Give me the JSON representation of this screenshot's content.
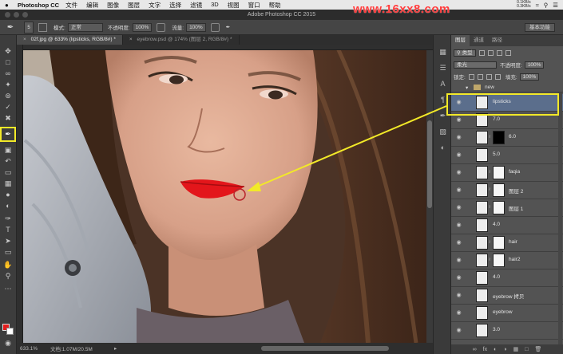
{
  "menubar": {
    "app_name": "Photoshop CC",
    "items": [
      "文件",
      "编辑",
      "图像",
      "图层",
      "文字",
      "选择",
      "滤镜",
      "3D",
      "视图",
      "窗口",
      "帮助"
    ],
    "rate_up": "0.1KB/s",
    "rate_down": "0.3KB/s"
  },
  "watermark": "www.16xx8.com",
  "window": {
    "title": "Adobe Photoshop CC 2015"
  },
  "options": {
    "brush_size": "5",
    "mode_label": "模式:",
    "mode_value": "正常",
    "opacity_label": "不透明度:",
    "opacity_value": "100%",
    "flow_label": "流量:",
    "flow_value": "100%",
    "workspace": "基本功能"
  },
  "tabs": [
    {
      "label": "02f.jpg @ 633% (lipsticks, RGB/8#) *",
      "active": true
    },
    {
      "label": "eyebrow.psd @ 174% (图层 2, RGB/8#) *",
      "active": false
    }
  ],
  "status": {
    "zoom": "633.1%",
    "doc": "文档:1.07M/20.5M"
  },
  "layers_panel": {
    "tabs": [
      "图层",
      "通道",
      "路径"
    ],
    "kind_label": "类型",
    "blend_mode": "柔光",
    "opacity_label": "不透明度:",
    "opacity_value": "100%",
    "lock_label": "锁定:",
    "fill_label": "填充:",
    "fill_value": "100%",
    "folder_name": "new",
    "layers": [
      {
        "name": "lipsticks",
        "selected": true,
        "mask": "none"
      },
      {
        "name": "7.0",
        "selected": false,
        "mask": "none"
      },
      {
        "name": "6.0",
        "selected": false,
        "mask": "black"
      },
      {
        "name": "5.0",
        "selected": false,
        "mask": "none"
      },
      {
        "name": "faqia",
        "selected": false,
        "mask": "white"
      },
      {
        "name": "图层 2",
        "selected": false,
        "mask": "white"
      },
      {
        "name": "图层 1",
        "selected": false,
        "mask": "white"
      },
      {
        "name": "4.0",
        "selected": false,
        "mask": "none"
      },
      {
        "name": "hair",
        "selected": false,
        "mask": "white"
      },
      {
        "name": "hair2",
        "selected": false,
        "mask": "white"
      },
      {
        "name": "4.0",
        "selected": false,
        "mask": "none"
      },
      {
        "name": "eyebrow 拷贝",
        "selected": false,
        "mask": "none"
      },
      {
        "name": "eyebrow",
        "selected": false,
        "mask": "none"
      },
      {
        "name": "3.0",
        "selected": false,
        "mask": "none"
      }
    ]
  },
  "colors": {
    "foreground": "#e21c1c",
    "background": "#ffffff",
    "highlight": "#f2e928",
    "selected_layer": "#5b6e8c"
  }
}
